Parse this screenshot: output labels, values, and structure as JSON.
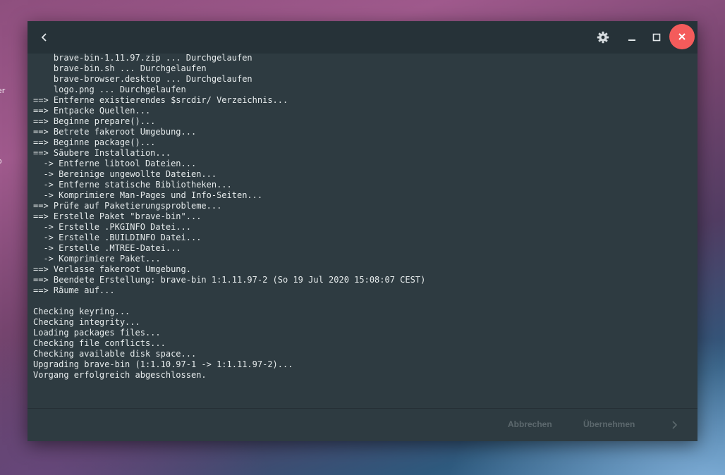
{
  "desktop": {
    "labels": [
      "er",
      "o"
    ]
  },
  "window": {
    "titlebar": {
      "back_icon": "chevron-left-icon",
      "settings_icon": "gear-icon",
      "minimize_icon": "minimize-icon",
      "maximize_icon": "maximize-icon",
      "close_icon": "close-icon",
      "close_color": "#f45b5b"
    },
    "terminal": {
      "text": "    userpref-source-stealth.md ... Durchgelaufen\n    brave-bin-1.11.97.zip ... Durchgelaufen\n    brave-bin.sh ... Durchgelaufen\n    brave-browser.desktop ... Durchgelaufen\n    logo.png ... Durchgelaufen\n==> Entferne existierendes $srcdir/ Verzeichnis...\n==> Entpacke Quellen...\n==> Beginne prepare()...\n==> Betrete fakeroot Umgebung...\n==> Beginne package()...\n==> Säubere Installation...\n  -> Entferne libtool Dateien...\n  -> Bereinige ungewollte Dateien...\n  -> Entferne statische Bibliotheken...\n  -> Komprimiere Man-Pages und Info-Seiten...\n==> Prüfe auf Paketierungsprobleme...\n==> Erstelle Paket \"brave-bin\"...\n  -> Erstelle .PKGINFO Datei...\n  -> Erstelle .BUILDINFO Datei...\n  -> Erstelle .MTREE-Datei...\n  -> Komprimiere Paket...\n==> Verlasse fakeroot Umgebung.\n==> Beendete Erstellung: brave-bin 1:1.11.97-2 (So 19 Jul 2020 15:08:07 CEST)\n==> Räume auf...\n\nChecking keyring...\nChecking integrity...\nLoading packages files...\nChecking file conflicts...\nChecking available disk space...\nUpgrading brave-bin (1:1.10.97-1 -> 1:1.11.97-2)...\nVorgang erfolgreich abgeschlossen."
    },
    "footer": {
      "abort_label": "Abbrechen",
      "apply_label": "Übernehmen",
      "next_icon": "chevron-right-icon"
    }
  }
}
